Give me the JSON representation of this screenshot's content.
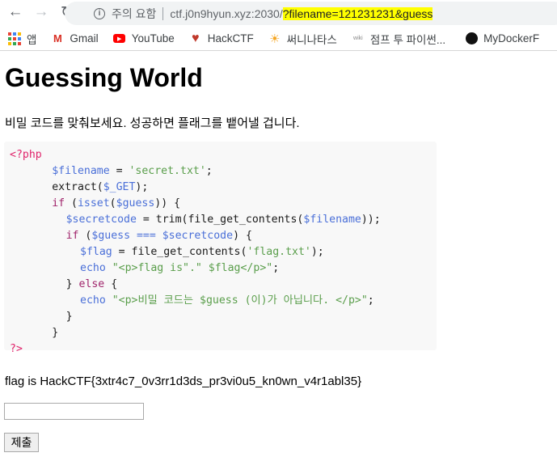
{
  "browser": {
    "security_warning": "주의 요함",
    "url_host": "ctf.j0n9hyun.xyz:2030/",
    "url_query": "?filename=121231231&guess",
    "bookmarks": [
      {
        "label": "앱",
        "icon": "apps-grid-icon"
      },
      {
        "label": "Gmail",
        "icon": "gmail-icon"
      },
      {
        "label": "YouTube",
        "icon": "youtube-icon"
      },
      {
        "label": "HackCTF",
        "icon": "heart-icon"
      },
      {
        "label": "써니나타스",
        "icon": "sun-icon"
      },
      {
        "label": "점프 투 파이썬...",
        "icon": "wiki-icon"
      },
      {
        "label": "MyDockerF",
        "icon": "github-icon"
      }
    ]
  },
  "page": {
    "title": "Guessing World",
    "description": "비밀 코드를 맞춰보세요. 성공하면 플래그를 뱉어낼 겁니다.",
    "code_colors": {
      "tag": "#e0246b",
      "var": "#4a6fd8",
      "str": "#5a9e4b",
      "kw": "#a0246b",
      "fn": "#4a6fd8",
      "plain": "#1a1a1a"
    },
    "code_lines": [
      {
        "indent": 0,
        "tokens": [
          [
            "<?php",
            "tag"
          ]
        ]
      },
      {
        "indent": 6,
        "tokens": [
          [
            "$filename",
            "var"
          ],
          [
            " = ",
            "plain"
          ],
          [
            "'secret.txt'",
            "str"
          ],
          [
            ";",
            "plain"
          ]
        ]
      },
      {
        "indent": 6,
        "tokens": [
          [
            "extract(",
            "plain"
          ],
          [
            "$_GET",
            "var"
          ],
          [
            ");",
            "plain"
          ]
        ]
      },
      {
        "indent": 6,
        "tokens": [
          [
            "if",
            "kw"
          ],
          [
            " (",
            "plain"
          ],
          [
            "isset",
            "fn"
          ],
          [
            "(",
            "plain"
          ],
          [
            "$guess",
            "var"
          ],
          [
            ")) {",
            "plain"
          ]
        ]
      },
      {
        "indent": 8,
        "tokens": [
          [
            "$secretcode",
            "var"
          ],
          [
            " = trim(file_get_contents(",
            "plain"
          ],
          [
            "$filename",
            "var"
          ],
          [
            "));",
            "plain"
          ]
        ]
      },
      {
        "indent": 8,
        "tokens": [
          [
            "if",
            "kw"
          ],
          [
            " (",
            "plain"
          ],
          [
            "$guess",
            "var"
          ],
          [
            " === ",
            "var"
          ],
          [
            "$secretcode",
            "var"
          ],
          [
            ") {",
            "plain"
          ]
        ]
      },
      {
        "indent": 10,
        "tokens": [
          [
            "$flag",
            "var"
          ],
          [
            " = file_get_contents(",
            "plain"
          ],
          [
            "'flag.txt'",
            "str"
          ],
          [
            ");",
            "plain"
          ]
        ]
      },
      {
        "indent": 10,
        "tokens": [
          [
            "echo",
            "fn"
          ],
          [
            " \"<p>flag is\".\" $flag</p>\"",
            "str"
          ],
          [
            ";",
            "plain"
          ]
        ]
      },
      {
        "indent": 8,
        "tokens": [
          [
            "} ",
            "plain"
          ],
          [
            "else",
            "kw"
          ],
          [
            " {",
            "plain"
          ]
        ]
      },
      {
        "indent": 10,
        "tokens": [
          [
            "echo",
            "fn"
          ],
          [
            " \"<p>비밀 코드는 $guess (이)가 아닙니다. </p>\"",
            "str"
          ],
          [
            ";",
            "plain"
          ]
        ]
      },
      {
        "indent": 8,
        "tokens": [
          [
            "}",
            "plain"
          ]
        ]
      },
      {
        "indent": 6,
        "tokens": [
          [
            "}",
            "plain"
          ]
        ]
      },
      {
        "indent": 0,
        "tokens": [
          [
            "?>",
            "tag"
          ]
        ]
      }
    ],
    "result": "flag is HackCTF{3xtr4c7_0v3rr1d3ds_pr3vi0u5_kn0wn_v4r1abl35}",
    "guess_input_value": "",
    "submit_label": "제출"
  }
}
